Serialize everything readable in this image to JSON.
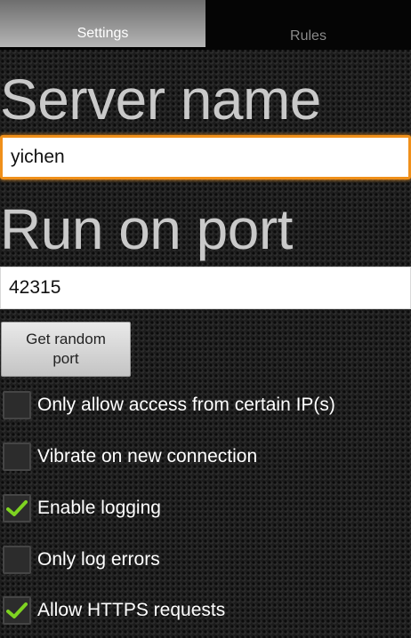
{
  "tabs": [
    {
      "label": "Settings",
      "active": true
    },
    {
      "label": "Rules",
      "active": false
    }
  ],
  "server_name": {
    "label": "Server name",
    "value": "yichen"
  },
  "port": {
    "label": "Run on port",
    "value": "42315"
  },
  "random_port_button": {
    "label": "Get random port"
  },
  "options": [
    {
      "label": "Only allow access from certain IP(s)",
      "checked": false
    },
    {
      "label": "Vibrate on new connection",
      "checked": false
    },
    {
      "label": "Enable logging",
      "checked": true
    },
    {
      "label": "Only log errors",
      "checked": false
    },
    {
      "label": "Allow HTTPS requests",
      "checked": true
    }
  ],
  "colors": {
    "focus_accent": "#f0901a",
    "check_mark": "#7ed321"
  },
  "icons": {
    "check": "check-icon"
  }
}
